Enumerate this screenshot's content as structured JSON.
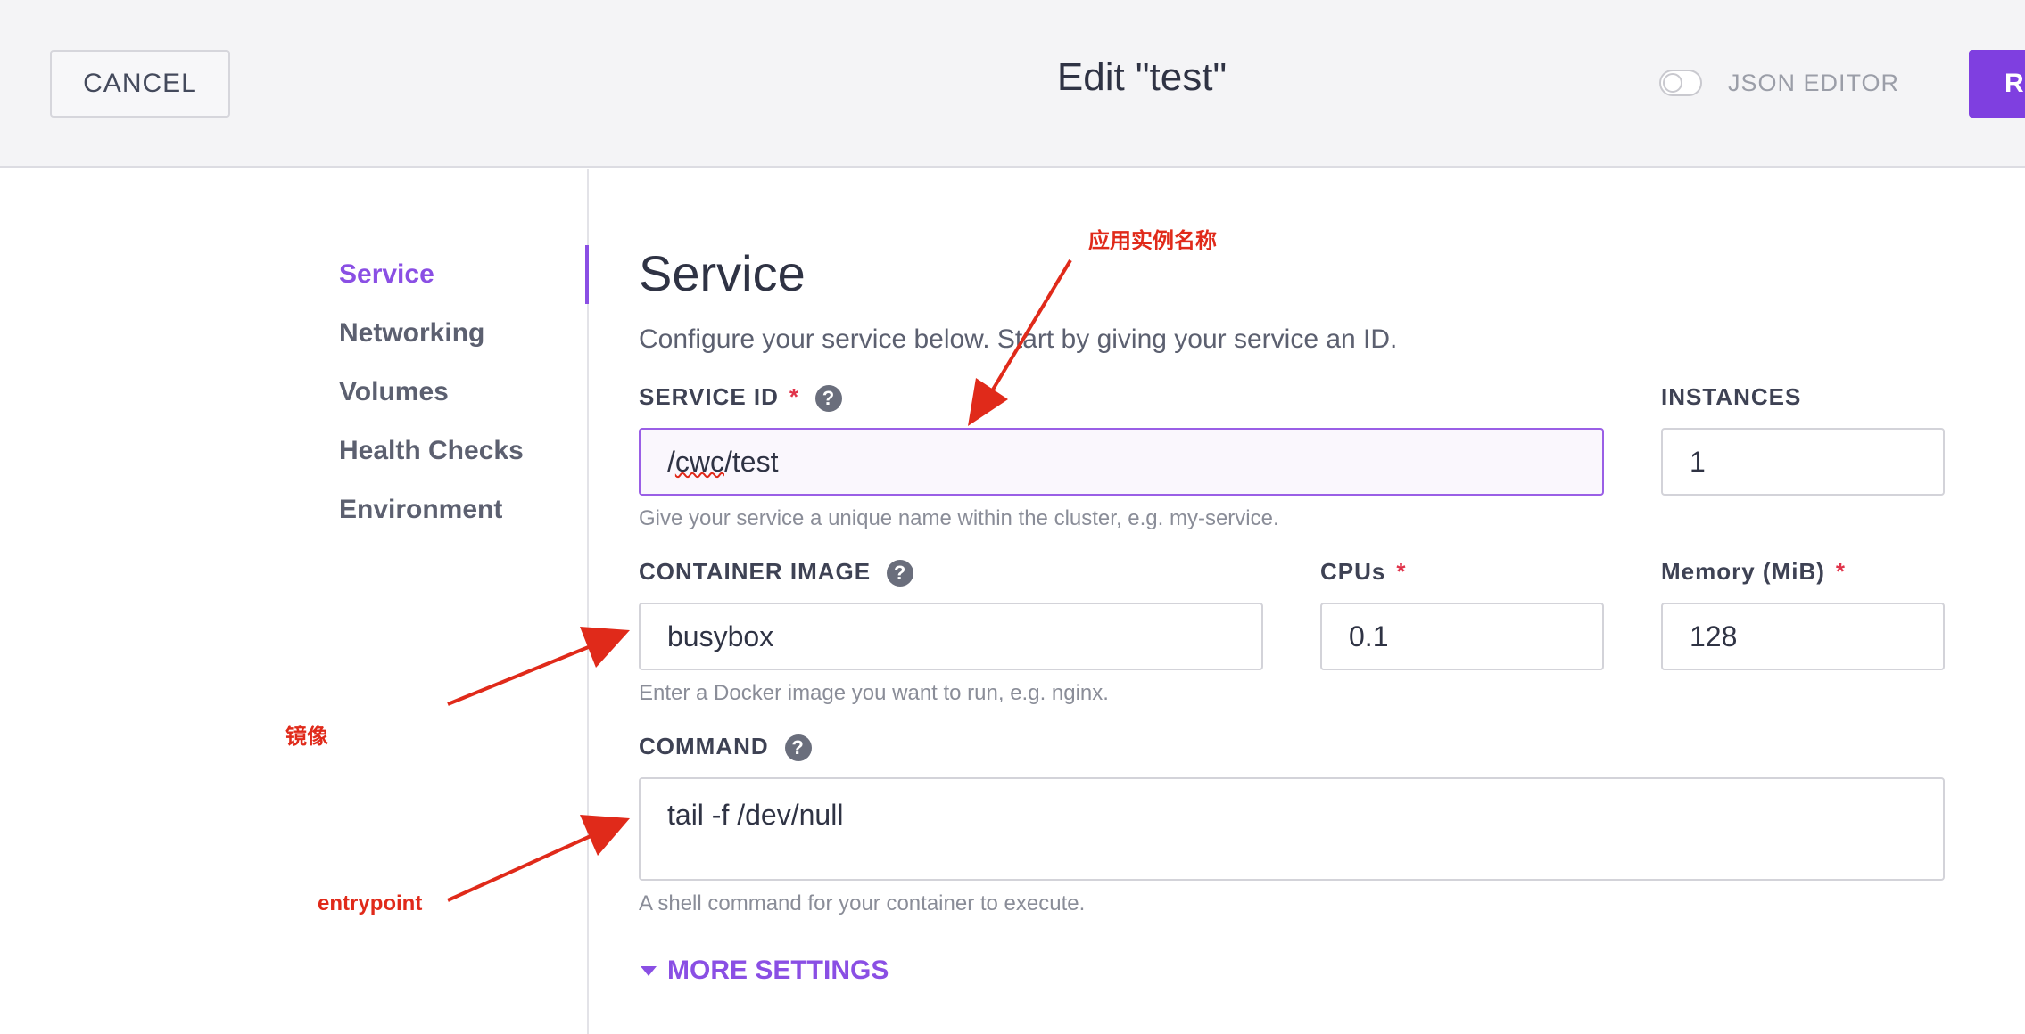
{
  "header": {
    "cancel_label": "CANCEL",
    "title": "Edit \"test\"",
    "json_editor_label": "JSON EDITOR",
    "json_editor_enabled": false,
    "review_label": "RE"
  },
  "nav": {
    "items": [
      {
        "label": "Service",
        "active": true
      },
      {
        "label": "Networking",
        "active": false
      },
      {
        "label": "Volumes",
        "active": false
      },
      {
        "label": "Health Checks",
        "active": false
      },
      {
        "label": "Environment",
        "active": false
      }
    ]
  },
  "main": {
    "title": "Service",
    "description": "Configure your service below. Start by giving your service an ID.",
    "service_id": {
      "label": "SERVICE ID",
      "required_mark": "*",
      "help_icon": "question-icon",
      "value_prefix": "/",
      "value_underlined": "cwc",
      "value_suffix": "/test",
      "hint": "Give your service a unique name within the cluster, e.g. my-service."
    },
    "instances": {
      "label": "INSTANCES",
      "value": "1"
    },
    "container_image": {
      "label": "CONTAINER IMAGE",
      "help_icon": "question-icon",
      "value": "busybox",
      "hint": "Enter a Docker image you want to run, e.g. nginx."
    },
    "cpus": {
      "label": "CPUs",
      "required_mark": "*",
      "value": "0.1"
    },
    "memory": {
      "label": "Memory (MiB)",
      "required_mark": "*",
      "value": "128"
    },
    "command": {
      "label": "COMMAND",
      "help_icon": "question-icon",
      "value": "tail -f /dev/null",
      "hint": "A shell command for your container to execute."
    },
    "more_settings_label": "MORE SETTINGS"
  },
  "annotations": {
    "service_name_note": "应用实例名称",
    "image_note": "镜像",
    "entrypoint_note": "entrypoint",
    "color": "#e02a1a"
  },
  "colors": {
    "accent": "#8a4fe4",
    "required": "#e0334a",
    "primary_button": "#7f3fe0"
  }
}
